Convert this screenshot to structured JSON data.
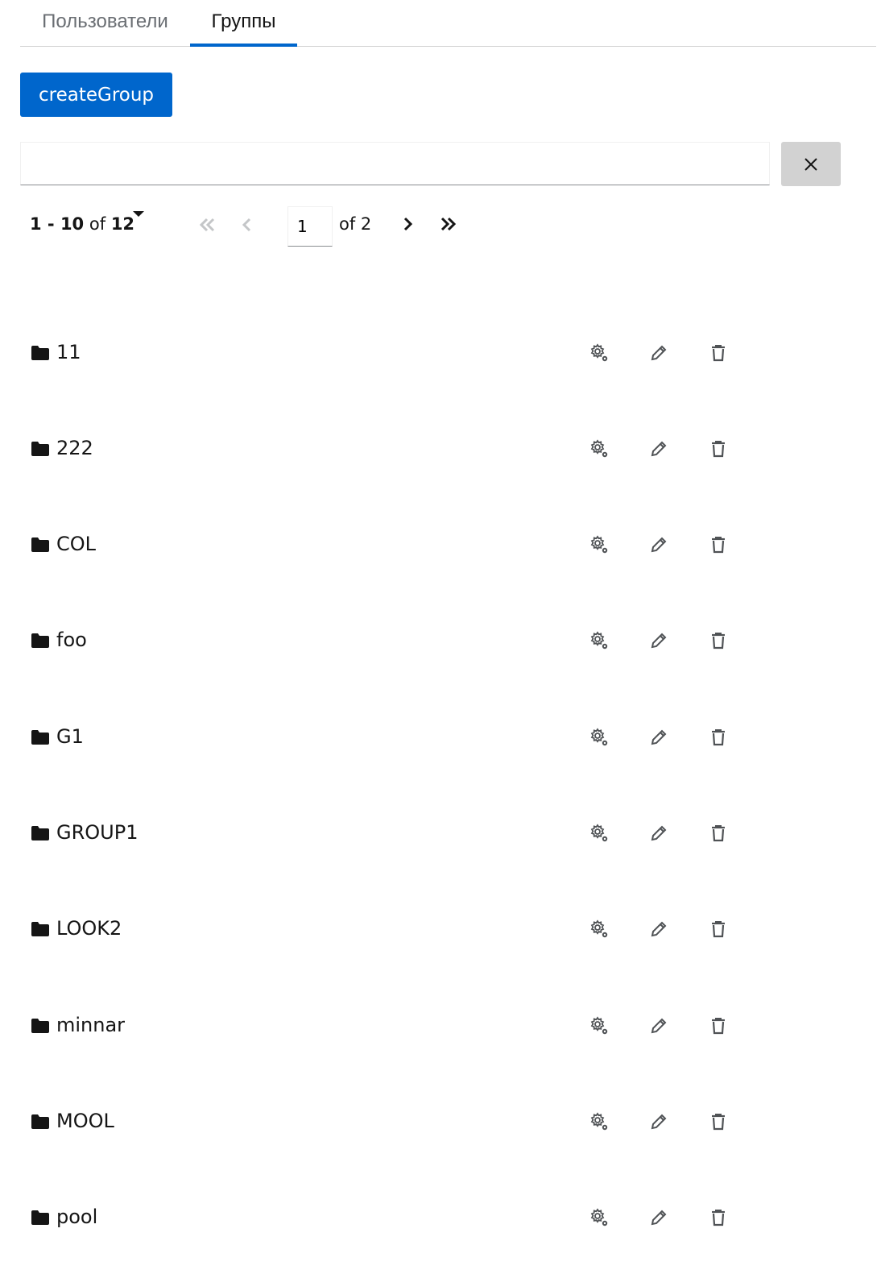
{
  "tabs": [
    {
      "label": "Пользователи",
      "active": false
    },
    {
      "label": "Группы",
      "active": true
    }
  ],
  "toolbar": {
    "create_label": "createGroup"
  },
  "search": {
    "value": "",
    "placeholder": ""
  },
  "pagination": {
    "range": "1 - 10",
    "of_word": "of",
    "total": "12",
    "current_page": "1",
    "of_pages": "of 2"
  },
  "groups": [
    {
      "name": "11"
    },
    {
      "name": "222"
    },
    {
      "name": "COL"
    },
    {
      "name": "foo"
    },
    {
      "name": "G1"
    },
    {
      "name": "GROUP1"
    },
    {
      "name": "LOOK2"
    },
    {
      "name": "minnar"
    },
    {
      "name": "MOOL"
    },
    {
      "name": "pool"
    }
  ],
  "icons": {
    "row_type": "folder-icon",
    "row_actions": [
      "settings-icon",
      "edit-icon",
      "trash-icon"
    ],
    "pager": [
      "first-page-icon",
      "previous-page-icon",
      "next-page-icon",
      "last-page-icon"
    ]
  },
  "colors": {
    "accent": "#0066cc",
    "clear_button": "#d2d2d2",
    "muted": "#6a6e73"
  }
}
